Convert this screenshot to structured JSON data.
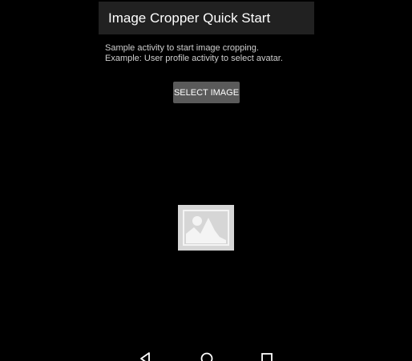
{
  "app_bar": {
    "title": "Image Cropper Quick Start",
    "background": "#212121"
  },
  "description": {
    "line1": "Sample activity to start image cropping.",
    "line2": "Example: User profile activity to select avatar."
  },
  "select_button": {
    "label": "SELECT IMAGE",
    "background": "#5a5a5a"
  },
  "image_view": {
    "icon": "image-placeholder-icon"
  },
  "nav_bar": {
    "back_icon": "back-triangle-icon",
    "home_icon": "home-circle-icon",
    "recents_icon": "recents-square-icon"
  }
}
